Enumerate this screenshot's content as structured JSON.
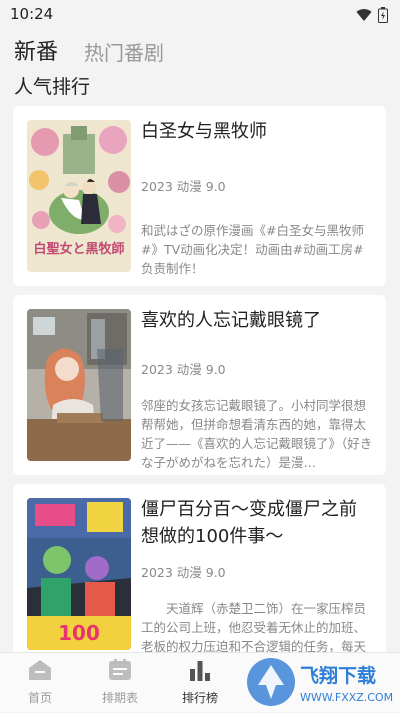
{
  "status_bar": {
    "time": "10:24"
  },
  "tabs": [
    {
      "label": "新番",
      "active": true
    },
    {
      "label": "热门番剧",
      "active": false
    }
  ],
  "section_title": "人气排行",
  "cards": [
    {
      "title": "白圣女与黑牧师",
      "meta": "2023 动漫 9.0",
      "desc": "和武はざの原作漫画《#白圣女与黑牧师#》TV动画化决定！动画由#动画工房#负责制作！",
      "cover_text": "白聖女と黒牧師"
    },
    {
      "title": "喜欢的人忘记戴眼镜了",
      "meta": "2023 动漫 9.0",
      "desc": "邻座的女孩忘记戴眼镜了。小村同学很想帮帮她，但拼命想看清东西的她，靠得太近了——《喜欢的人忘记戴眼镜了》（好きな子がめがねを忘れた）是漫…"
    },
    {
      "title": "僵尸百分百～变成僵尸之前想做的100件事～",
      "meta": "2023 动漫 9.0",
      "desc": "　　天道辉（赤楚卫二饰）在一家压榨员工的公司上班，他忍受着无休止的加班、老板的权力压迫和不合逻辑的任务，每天都感觉生不如死。一天早上…"
    }
  ],
  "bottom_nav": [
    {
      "label": "首页",
      "icon": "home-icon",
      "active": false
    },
    {
      "label": "排期表",
      "icon": "schedule-icon",
      "active": false
    },
    {
      "label": "排行榜",
      "icon": "ranking-icon",
      "active": true
    },
    {
      "label": "",
      "icon": "hidden-nav-icon",
      "active": false
    },
    {
      "label": "",
      "icon": "hidden-nav-icon",
      "active": false
    }
  ],
  "watermark": {
    "text": "飞翔下载",
    "url_text": "WWW.FXXZ.COM"
  }
}
